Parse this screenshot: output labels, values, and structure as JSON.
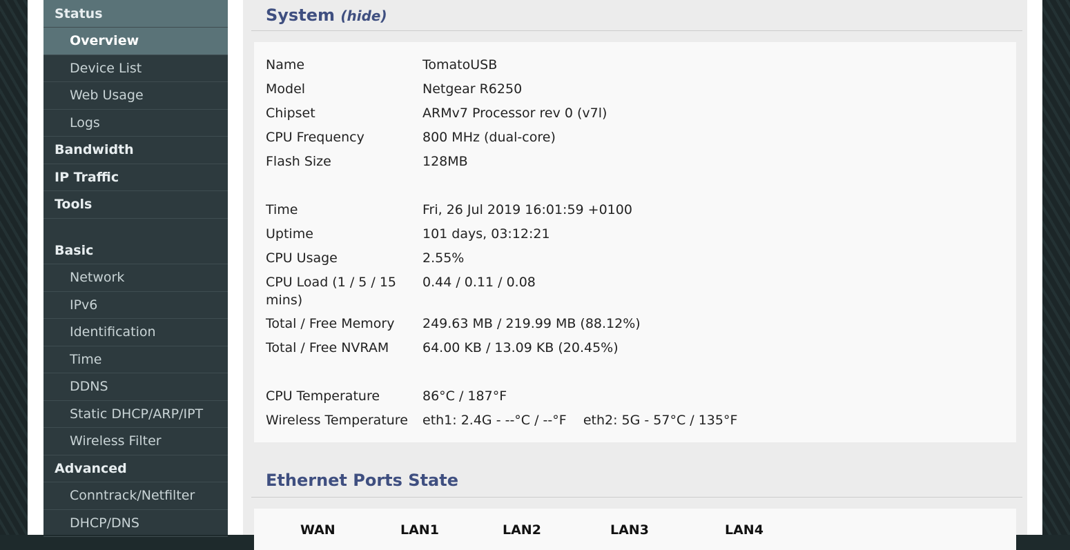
{
  "sidebar": {
    "items": [
      {
        "label": "Status",
        "type": "h"
      },
      {
        "label": "Overview",
        "type": "act"
      },
      {
        "label": "Device List"
      },
      {
        "label": "Web Usage"
      },
      {
        "label": "Logs"
      },
      {
        "label": "Bandwidth",
        "type": "h"
      },
      {
        "label": "IP Traffic",
        "type": "h"
      },
      {
        "label": "Tools",
        "type": "h"
      },
      {
        "label": "Basic",
        "type": "h"
      },
      {
        "label": "Network"
      },
      {
        "label": "IPv6"
      },
      {
        "label": "Identification"
      },
      {
        "label": "Time"
      },
      {
        "label": "DDNS"
      },
      {
        "label": "Static DHCP/ARP/IPT"
      },
      {
        "label": "Wireless Filter"
      },
      {
        "label": "Advanced",
        "type": "h"
      },
      {
        "label": "Conntrack/Netfilter"
      },
      {
        "label": "DHCP/DNS"
      }
    ]
  },
  "system": {
    "title": "System",
    "hide": "(hide)",
    "rows": [
      [
        "Name",
        "TomatoUSB"
      ],
      [
        "Model",
        "Netgear R6250"
      ],
      [
        "Chipset",
        "ARMv7 Processor rev 0 (v7l)"
      ],
      [
        "CPU Frequency",
        "800 MHz (dual-core)"
      ],
      [
        "Flash Size",
        "128MB"
      ],
      null,
      [
        "Time",
        "Fri, 26 Jul 2019 16:01:59 +0100"
      ],
      [
        "Uptime",
        "101 days, 03:12:21"
      ],
      [
        "CPU Usage",
        "2.55%"
      ],
      [
        "CPU Load (1 / 5 / 15 mins)",
        "0.44 / 0.11 / 0.08"
      ],
      [
        "Total / Free Memory",
        "249.63 MB / 219.99 MB (88.12%)"
      ],
      [
        "Total / Free NVRAM",
        "64.00 KB / 13.09 KB (20.45%)"
      ],
      null,
      [
        "CPU Temperature",
        "86°C / 187°F"
      ],
      [
        "Wireless Temperature",
        "eth1: 2.4G - --°C / --°F    eth2: 5G - 57°C / 135°F"
      ]
    ]
  },
  "ethernet": {
    "title": "Ethernet Ports State",
    "ports": [
      "WAN",
      "LAN1",
      "LAN2",
      "LAN3",
      "LAN4"
    ]
  }
}
